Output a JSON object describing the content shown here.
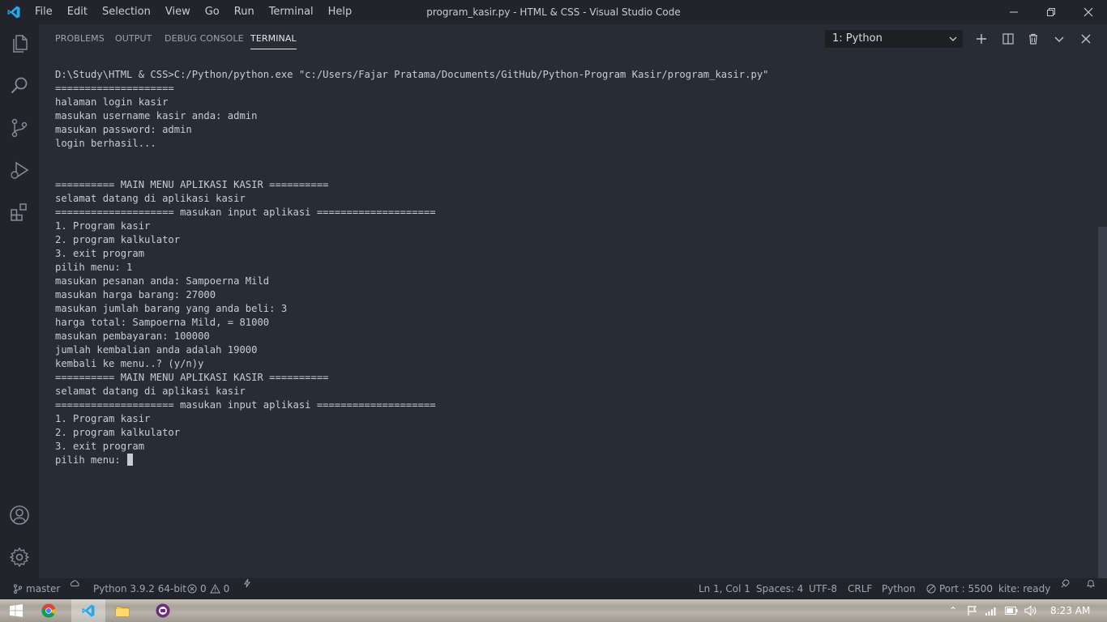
{
  "titlebar": {
    "menu": [
      "File",
      "Edit",
      "Selection",
      "View",
      "Go",
      "Run",
      "Terminal",
      "Help"
    ],
    "title": "program_kasir.py - HTML & CSS - Visual Studio Code"
  },
  "activity_icons": [
    "explorer-icon",
    "search-icon",
    "source-control-icon",
    "run-debug-icon",
    "extensions-icon",
    "accounts-icon",
    "manage-gear-icon"
  ],
  "panel": {
    "tabs": [
      "PROBLEMS",
      "OUTPUT",
      "DEBUG CONSOLE",
      "TERMINAL"
    ],
    "active_tab": "TERMINAL",
    "terminal_select": "1: Python"
  },
  "terminal": {
    "lines": [
      "D:\\Study\\HTML & CSS>C:/Python/python.exe \"c:/Users/Fajar Pratama/Documents/GitHub/Python-Program Kasir/program_kasir.py\"",
      "====================",
      "halaman login kasir",
      "masukan username kasir anda: admin",
      "masukan password: admin",
      "login berhasil...",
      "",
      "",
      "========== MAIN MENU APLIKASI KASIR ==========",
      "selamat datang di aplikasi kasir",
      "==================== masukan input aplikasi ====================",
      "1. Program kasir",
      "2. program kalkulator",
      "3. exit program",
      "pilih menu: 1",
      "masukan pesanan anda: Sampoerna Mild",
      "masukan harga barang: 27000",
      "masukan jumlah barang yang anda beli: 3",
      "harga total: Sampoerna Mild, = 81000",
      "masukan pembayaran: 100000",
      "jumlah kembalian anda adalah 19000",
      "kembali ke menu..? (y/n)y",
      "========== MAIN MENU APLIKASI KASIR ==========",
      "selamat datang di aplikasi kasir",
      "==================== masukan input aplikasi ====================",
      "1. Program kasir",
      "2. program kalkulator",
      "3. exit program"
    ],
    "prompt": "pilih menu: "
  },
  "statusbar": {
    "branch": "master",
    "interpreter": "Python 3.9.2 64-bit",
    "errors": "0",
    "warnings": "0",
    "position": "Ln 1, Col 1",
    "spaces": "Spaces: 4",
    "encoding": "UTF-8",
    "eol": "CRLF",
    "language": "Python",
    "port": "Port : 5500",
    "kite": "kite: ready"
  },
  "taskbar": {
    "clock": "8:23 AM"
  }
}
